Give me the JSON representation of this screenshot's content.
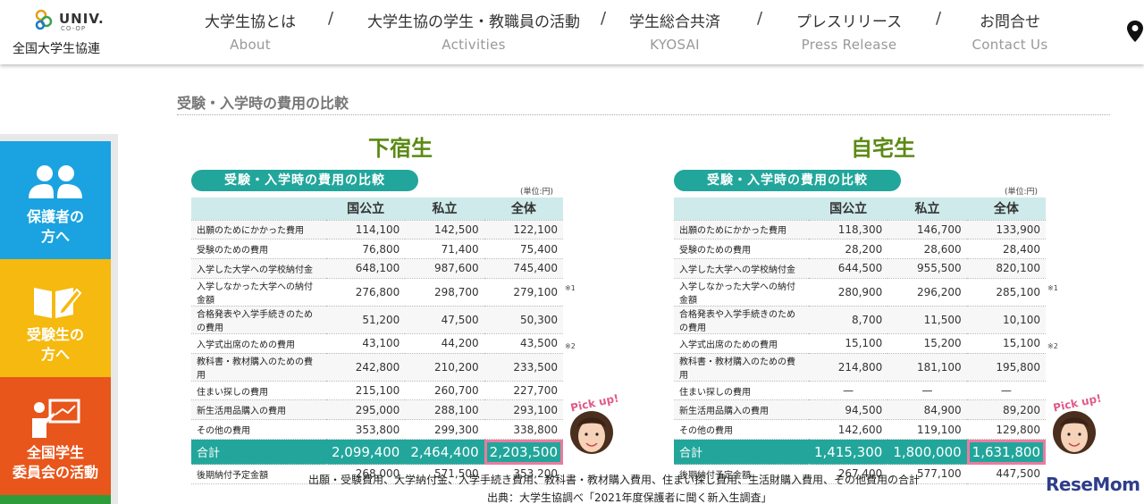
{
  "header": {
    "logo_brand": "UNIV.",
    "logo_sub": "CO-OP",
    "logo_name": "全国大学生協連",
    "nav": [
      {
        "ja": "大学生協とは",
        "en": "About"
      },
      {
        "ja": "大学生協の学生・教職員の活動",
        "en": "Activities"
      },
      {
        "ja": "学生総合共済",
        "en": "KYOSAI"
      },
      {
        "ja": "プレスリリース",
        "en": "Press Release"
      },
      {
        "ja": "お問合せ",
        "en": "Contact Us"
      }
    ],
    "separator": "/"
  },
  "sidebar": {
    "items": [
      {
        "label1": "保護者の",
        "label2": "方へ",
        "color": "#1aa3e0"
      },
      {
        "label1": "受験生の",
        "label2": "方へ",
        "color": "#f5b90f"
      },
      {
        "label1": "全国学生",
        "label2": "委員会の活動",
        "color": "#e8561c"
      }
    ]
  },
  "page_heading": "受験・入学時の費用の比較",
  "panels": [
    {
      "title": "下宿生",
      "pill": "受験・入学時の費用の比較",
      "unit": "(単位:円)",
      "columns": [
        "国公立",
        "私立",
        "全体"
      ],
      "rows": [
        {
          "label": "出願のためにかかった費用",
          "v": [
            "114,100",
            "142,500",
            "122,100"
          ],
          "note": ""
        },
        {
          "label": "受験のための費用",
          "v": [
            "76,800",
            "71,400",
            "75,400"
          ],
          "note": ""
        },
        {
          "label": "入学した大学への学校納付金",
          "v": [
            "648,100",
            "987,600",
            "745,400"
          ],
          "note": ""
        },
        {
          "label": "入学しなかった大学への納付金額",
          "v": [
            "276,800",
            "298,700",
            "279,100"
          ],
          "note": "※1"
        },
        {
          "label": "合格発表や入学手続きのための費用",
          "v": [
            "51,200",
            "47,500",
            "50,300"
          ],
          "note": ""
        },
        {
          "label": "入学式出席のための費用",
          "v": [
            "43,100",
            "44,200",
            "43,500"
          ],
          "note": ""
        },
        {
          "label": "教科書・教材購入のための費用",
          "v": [
            "242,800",
            "210,200",
            "233,500"
          ],
          "note": "※2"
        },
        {
          "label": "住まい探しの費用",
          "v": [
            "215,100",
            "260,700",
            "227,700"
          ],
          "note": ""
        },
        {
          "label": "新生活用品購入の費用",
          "v": [
            "295,000",
            "288,100",
            "293,100"
          ],
          "note": ""
        },
        {
          "label": "その他の費用",
          "v": [
            "353,800",
            "299,300",
            "338,800"
          ],
          "note": ""
        }
      ],
      "total": {
        "label": "合計",
        "v": [
          "2,099,400",
          "2,464,400",
          "2,203,500"
        ]
      },
      "after": {
        "label": "後期納付予定金額",
        "v": [
          "268,000",
          "571,500",
          "353,200"
        ]
      },
      "pickup": "Pick up!"
    },
    {
      "title": "自宅生",
      "pill": "受験・入学時の費用の比較",
      "unit": "(単位:円)",
      "columns": [
        "国公立",
        "私立",
        "全体"
      ],
      "rows": [
        {
          "label": "出願のためにかかった費用",
          "v": [
            "118,300",
            "146,700",
            "133,900"
          ],
          "note": ""
        },
        {
          "label": "受験のための費用",
          "v": [
            "28,200",
            "28,600",
            "28,400"
          ],
          "note": ""
        },
        {
          "label": "入学した大学への学校納付金",
          "v": [
            "644,500",
            "955,500",
            "820,100"
          ],
          "note": ""
        },
        {
          "label": "入学しなかった大学への納付金額",
          "v": [
            "280,900",
            "296,200",
            "285,100"
          ],
          "note": "※1"
        },
        {
          "label": "合格発表や入学手続きのための費用",
          "v": [
            "8,700",
            "11,500",
            "10,100"
          ],
          "note": ""
        },
        {
          "label": "入学式出席のための費用",
          "v": [
            "15,100",
            "15,200",
            "15,100"
          ],
          "note": ""
        },
        {
          "label": "教科書・教材購入のための費用",
          "v": [
            "214,800",
            "181,100",
            "195,800"
          ],
          "note": "※2"
        },
        {
          "label": "住まい探しの費用",
          "v": [
            "—",
            "—",
            "—"
          ],
          "note": ""
        },
        {
          "label": "新生活用品購入の費用",
          "v": [
            "94,500",
            "84,900",
            "89,200"
          ],
          "note": ""
        },
        {
          "label": "その他の費用",
          "v": [
            "142,600",
            "119,100",
            "129,800"
          ],
          "note": ""
        }
      ],
      "total": {
        "label": "合計",
        "v": [
          "1,415,300",
          "1,800,000",
          "1,631,800"
        ]
      },
      "after": {
        "label": "後期納付予定金額",
        "v": [
          "267,400",
          "577,100",
          "447,500"
        ]
      },
      "pickup": "Pick up!"
    }
  ],
  "footer": {
    "line1": "出願・受験費用、大学納付金、入学手続き費用、教科書・教材購入費用、住まい探し費用、生活財購入費用、その他費用の合計",
    "line2": "出典：大学生協調べ「2021年度保護者に聞く新入生調査」"
  },
  "watermark": "ReseMom"
}
